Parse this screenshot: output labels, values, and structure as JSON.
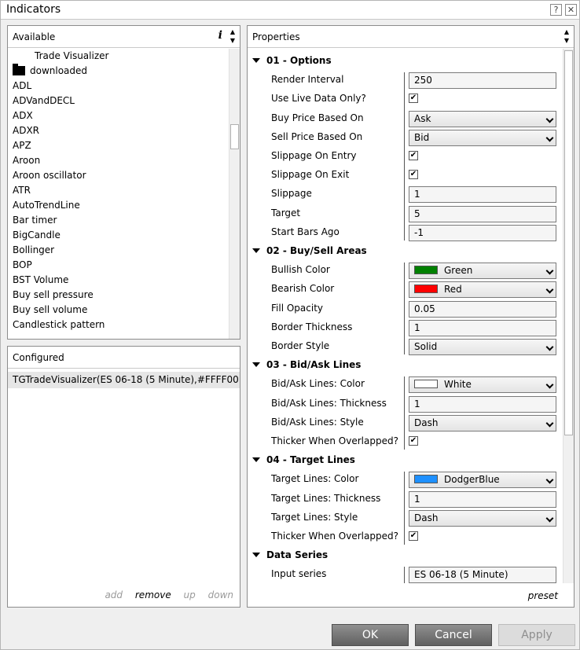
{
  "window": {
    "title": "Indicators",
    "help": "?",
    "close": "✕"
  },
  "available": {
    "header": "Available",
    "info": "i",
    "items": [
      "Trade Visualizer",
      "downloaded",
      "ADL",
      "ADVandDECL",
      "ADX",
      "ADXR",
      "APZ",
      "Aroon",
      "Aroon oscillator",
      "ATR",
      "AutoTrendLine",
      "Bar timer",
      "BigCandle",
      "Bollinger",
      "BOP",
      "BST Volume",
      "Buy sell pressure",
      "Buy sell volume",
      "Candlestick pattern"
    ]
  },
  "configured": {
    "header": "Configured",
    "items": [
      "TGTradeVisualizer(ES 06-18 (5 Minute),#FFFF00..."
    ],
    "links": {
      "add": "add",
      "remove": "remove",
      "up": "up",
      "down": "down"
    }
  },
  "properties": {
    "header": "Properties",
    "preset": "preset",
    "sections": [
      {
        "title": "01 - Options",
        "rows": [
          {
            "label": "Render Interval",
            "type": "text",
            "value": "250"
          },
          {
            "label": "Use Live Data Only?",
            "type": "check",
            "checked": true
          },
          {
            "label": "Buy Price Based On",
            "type": "select",
            "value": "Ask"
          },
          {
            "label": "Sell Price Based On",
            "type": "select",
            "value": "Bid"
          },
          {
            "label": "Slippage On Entry",
            "type": "check",
            "checked": true
          },
          {
            "label": "Slippage On Exit",
            "type": "check",
            "checked": true
          },
          {
            "label": "Slippage",
            "type": "text",
            "value": "1"
          },
          {
            "label": "Target",
            "type": "text",
            "value": "5"
          },
          {
            "label": "Start Bars Ago",
            "type": "text",
            "value": "-1"
          }
        ]
      },
      {
        "title": "02 - Buy/Sell Areas",
        "rows": [
          {
            "label": "Bullish Color",
            "type": "color",
            "value": "Green",
            "color": "#008000"
          },
          {
            "label": "Bearish Color",
            "type": "color",
            "value": "Red",
            "color": "#ff0000"
          },
          {
            "label": "Fill Opacity",
            "type": "text",
            "value": "0.05"
          },
          {
            "label": "Border Thickness",
            "type": "text",
            "value": "1"
          },
          {
            "label": "Border Style",
            "type": "select",
            "value": "Solid"
          }
        ]
      },
      {
        "title": "03 - Bid/Ask Lines",
        "rows": [
          {
            "label": "Bid/Ask Lines: Color",
            "type": "color",
            "value": "White",
            "color": "#ffffff"
          },
          {
            "label": "Bid/Ask Lines: Thickness",
            "type": "text",
            "value": "1"
          },
          {
            "label": "Bid/Ask Lines: Style",
            "type": "select",
            "value": "Dash"
          },
          {
            "label": "Thicker When Overlapped?",
            "type": "check",
            "checked": true
          }
        ]
      },
      {
        "title": "04 - Target Lines",
        "rows": [
          {
            "label": "Target Lines: Color",
            "type": "color",
            "value": "DodgerBlue",
            "color": "#1e90ff"
          },
          {
            "label": "Target Lines: Thickness",
            "type": "text",
            "value": "1"
          },
          {
            "label": "Target Lines: Style",
            "type": "select",
            "value": "Dash"
          },
          {
            "label": "Thicker When Overlapped?",
            "type": "check",
            "checked": true
          }
        ]
      },
      {
        "title": "Data Series",
        "rows": [
          {
            "label": "Input series",
            "type": "text",
            "value": "ES 06-18 (5 Minute)"
          }
        ]
      }
    ]
  },
  "buttons": {
    "ok": "OK",
    "cancel": "Cancel",
    "apply": "Apply"
  }
}
